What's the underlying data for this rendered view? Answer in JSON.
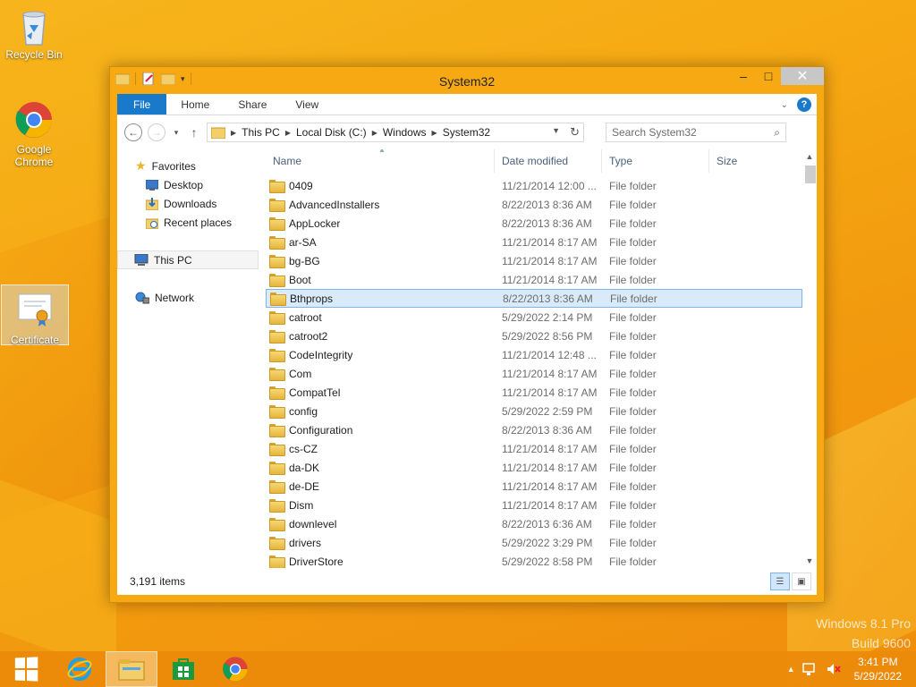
{
  "desktop": {
    "icons": [
      {
        "label": "Recycle Bin"
      },
      {
        "label": "Google Chrome"
      },
      {
        "label": "Certificate"
      }
    ],
    "watermark_line1": "Windows 8.1 Pro",
    "watermark_line2": "Build 9600"
  },
  "window": {
    "title": "System32",
    "controls": {
      "minimize": "–",
      "maximize": "□",
      "close": "✕"
    }
  },
  "ribbon": {
    "tabs": [
      "File",
      "Home",
      "Share",
      "View"
    ],
    "help": "?"
  },
  "navigation": {
    "back": "←",
    "forward": "→",
    "recent": "▾",
    "up": "↑",
    "breadcrumbs": [
      "This PC",
      "Local Disk (C:)",
      "Windows",
      "System32"
    ],
    "refresh": "↻",
    "search_placeholder": "Search System32"
  },
  "navpane": {
    "favorites": "Favorites",
    "desktop": "Desktop",
    "downloads": "Downloads",
    "recent_places": "Recent places",
    "this_pc": "This PC",
    "network": "Network"
  },
  "columns": {
    "name": "Name",
    "date": "Date modified",
    "type": "Type",
    "size": "Size"
  },
  "files": [
    {
      "name": "0409",
      "date": "11/21/2014 12:00 ...",
      "type": "File folder"
    },
    {
      "name": "AdvancedInstallers",
      "date": "8/22/2013 8:36 AM",
      "type": "File folder"
    },
    {
      "name": "AppLocker",
      "date": "8/22/2013 8:36 AM",
      "type": "File folder"
    },
    {
      "name": "ar-SA",
      "date": "11/21/2014 8:17 AM",
      "type": "File folder"
    },
    {
      "name": "bg-BG",
      "date": "11/21/2014 8:17 AM",
      "type": "File folder"
    },
    {
      "name": "Boot",
      "date": "11/21/2014 8:17 AM",
      "type": "File folder"
    },
    {
      "name": "Bthprops",
      "date": "8/22/2013 8:36 AM",
      "type": "File folder",
      "selected": true
    },
    {
      "name": "catroot",
      "date": "5/29/2022 2:14 PM",
      "type": "File folder"
    },
    {
      "name": "catroot2",
      "date": "5/29/2022 8:56 PM",
      "type": "File folder"
    },
    {
      "name": "CodeIntegrity",
      "date": "11/21/2014 12:48 ...",
      "type": "File folder"
    },
    {
      "name": "Com",
      "date": "11/21/2014 8:17 AM",
      "type": "File folder"
    },
    {
      "name": "CompatTel",
      "date": "11/21/2014 8:17 AM",
      "type": "File folder"
    },
    {
      "name": "config",
      "date": "5/29/2022 2:59 PM",
      "type": "File folder"
    },
    {
      "name": "Configuration",
      "date": "8/22/2013 8:36 AM",
      "type": "File folder"
    },
    {
      "name": "cs-CZ",
      "date": "11/21/2014 8:17 AM",
      "type": "File folder"
    },
    {
      "name": "da-DK",
      "date": "11/21/2014 8:17 AM",
      "type": "File folder"
    },
    {
      "name": "de-DE",
      "date": "11/21/2014 8:17 AM",
      "type": "File folder"
    },
    {
      "name": "Dism",
      "date": "11/21/2014 8:17 AM",
      "type": "File folder"
    },
    {
      "name": "downlevel",
      "date": "8/22/2013 6:36 AM",
      "type": "File folder"
    },
    {
      "name": "drivers",
      "date": "5/29/2022 3:29 PM",
      "type": "File folder"
    },
    {
      "name": "DriverStore",
      "date": "5/29/2022 8:58 PM",
      "type": "File folder"
    }
  ],
  "status": {
    "item_count": "3,191 items"
  },
  "taskbar": {
    "time": "3:41 PM",
    "date": "5/29/2022"
  }
}
